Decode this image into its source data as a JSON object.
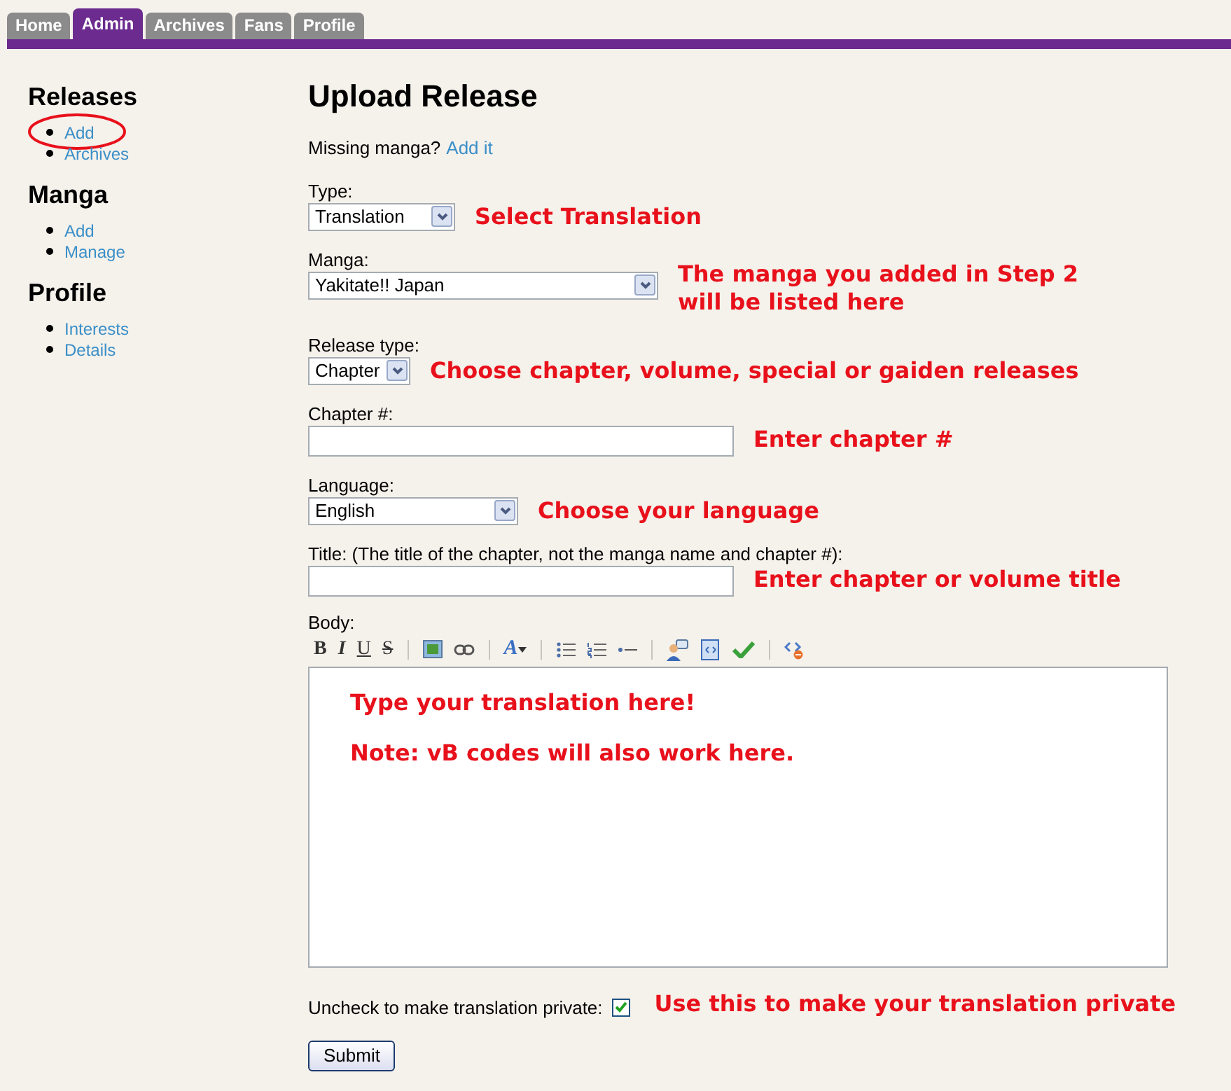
{
  "tabs": [
    {
      "label": "Home",
      "selected": false
    },
    {
      "label": "Admin",
      "selected": true
    },
    {
      "label": "Archives",
      "selected": false
    },
    {
      "label": "Fans",
      "selected": false
    },
    {
      "label": "Profile",
      "selected": false
    }
  ],
  "sidebar": [
    {
      "heading": "Releases",
      "items": [
        {
          "label": "Add",
          "circled": true
        },
        {
          "label": "Archives",
          "circled": false
        }
      ]
    },
    {
      "heading": "Manga",
      "items": [
        {
          "label": "Add",
          "circled": false
        },
        {
          "label": "Manage",
          "circled": false
        }
      ]
    },
    {
      "heading": "Profile",
      "items": [
        {
          "label": "Interests",
          "circled": false
        },
        {
          "label": "Details",
          "circled": false
        }
      ]
    }
  ],
  "title": "Upload Release",
  "missing": {
    "text": "Missing manga?",
    "link": "Add it"
  },
  "fields": [
    {
      "kind": "select",
      "label": "Type:",
      "value": "Translation",
      "note": [
        "Select Translation"
      ]
    },
    {
      "kind": "select",
      "label": "Manga:",
      "value": "Yakitate!! Japan",
      "note": [
        "The manga you added in Step 2",
        "will be listed here"
      ]
    },
    {
      "kind": "select",
      "label": "Release type:",
      "value": "Chapter",
      "note": [
        "Choose chapter, volume, special or gaiden releases"
      ]
    },
    {
      "kind": "input",
      "label": "Chapter #:",
      "note": [
        "Enter chapter #"
      ]
    },
    {
      "kind": "select",
      "label": "Language:",
      "value": "English",
      "note": [
        "Choose your language"
      ]
    },
    {
      "kind": "input",
      "label": "Title: (The title of the chapter, not the manga name and chapter #):",
      "note": [
        "Enter chapter or volume title"
      ]
    }
  ],
  "body": {
    "label": "Body:",
    "toolbar": [
      {
        "kind": "bold",
        "label": "B"
      },
      {
        "kind": "italic",
        "label": "I"
      },
      {
        "kind": "underline",
        "label": "U"
      },
      {
        "kind": "strike",
        "label": "S"
      },
      {
        "kind": "sep"
      },
      {
        "kind": "image"
      },
      {
        "kind": "link"
      },
      {
        "kind": "sep"
      },
      {
        "kind": "font",
        "label": "A"
      },
      {
        "kind": "sep"
      },
      {
        "kind": "bullets"
      },
      {
        "kind": "numbers"
      },
      {
        "kind": "rule"
      },
      {
        "kind": "sep"
      },
      {
        "kind": "quote"
      },
      {
        "kind": "code"
      },
      {
        "kind": "check"
      },
      {
        "kind": "sep"
      },
      {
        "kind": "source"
      }
    ],
    "lines": [
      "Type your translation here!",
      "Note: vB codes will also work here."
    ]
  },
  "public": {
    "label": "Uncheck to make translation private:",
    "checked": true,
    "note": "Use this to make your translation private"
  },
  "submit": "Submit"
}
